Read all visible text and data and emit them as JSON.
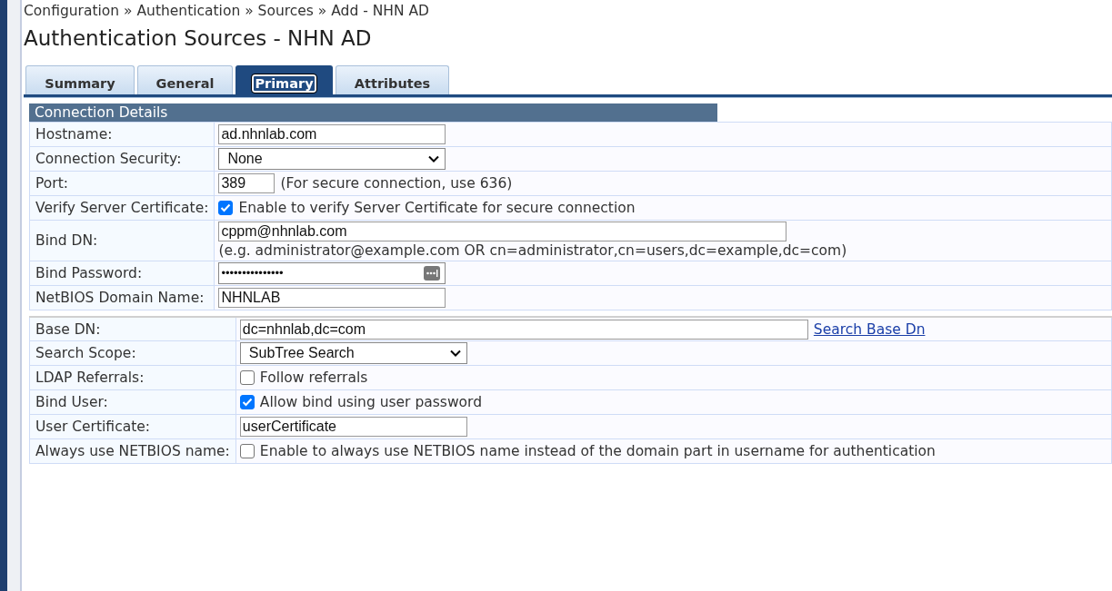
{
  "breadcrumb": "Configuration » Authentication » Sources » Add - NHN AD",
  "title": "Authentication Sources - NHN AD",
  "tabs": [
    {
      "label": "Summary",
      "selected": false
    },
    {
      "label": "General",
      "selected": false
    },
    {
      "label": "Primary",
      "selected": true
    },
    {
      "label": "Attributes",
      "selected": false
    }
  ],
  "section_title": "Connection Details",
  "groups": [
    [
      {
        "kind": "text",
        "label": "Hostname:",
        "value": "ad.nhnlab.com"
      },
      {
        "kind": "select",
        "label": "Connection Security:",
        "value": "None"
      },
      {
        "kind": "port",
        "label": "Port:",
        "value": "389",
        "note": "(For secure connection, use 636)"
      },
      {
        "kind": "checkbox",
        "label": "Verify Server Certificate:",
        "checked": true,
        "text": "Enable to verify Server Certificate for secure connection"
      },
      {
        "kind": "hint",
        "label": "Bind DN:",
        "value": "cppm@nhnlab.com",
        "note": "(e.g. administrator@example.com OR cn=administrator,cn=users,dc=example,dc=com)"
      },
      {
        "kind": "password",
        "label": "Bind Password:",
        "value": "•••••••••••••••"
      },
      {
        "kind": "text",
        "label": "NetBIOS Domain Name:",
        "value": "NHNLAB"
      }
    ],
    [
      {
        "kind": "link",
        "label": "Base DN:",
        "value": "dc=nhnlab,dc=com",
        "link": "Search Base Dn"
      },
      {
        "kind": "select",
        "label": "Search Scope:",
        "value": "SubTree Search"
      },
      {
        "kind": "checkbox",
        "label": "LDAP Referrals:",
        "checked": false,
        "text": "Follow referrals"
      },
      {
        "kind": "checkbox",
        "label": "Bind User:",
        "checked": true,
        "text": "Allow bind using user password"
      },
      {
        "kind": "text",
        "label": "User Certificate:",
        "value": "userCertificate"
      },
      {
        "kind": "checkbox",
        "label": "Always use NETBIOS name:",
        "checked": false,
        "text": "Enable to always use NETBIOS name instead of the domain part in username for authentication"
      }
    ]
  ]
}
